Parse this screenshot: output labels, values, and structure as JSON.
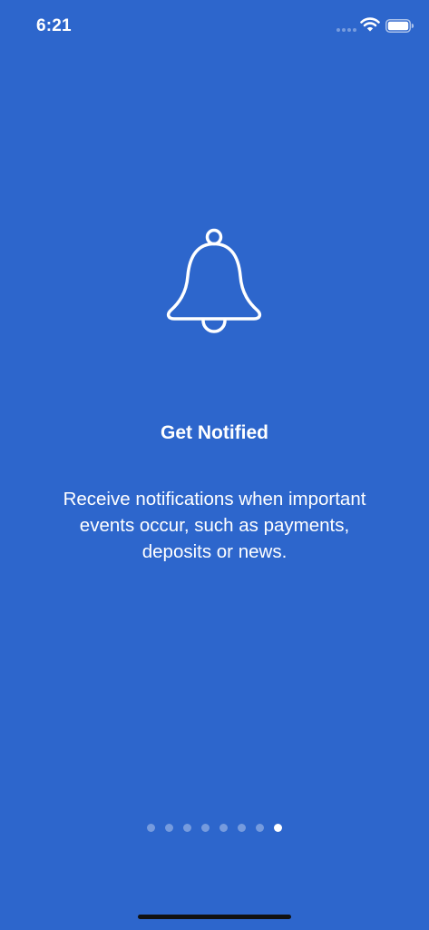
{
  "status_bar": {
    "time": "6:21",
    "icons": [
      "cellular-signal-icon",
      "wifi-icon",
      "battery-icon"
    ]
  },
  "onboarding": {
    "icon": "bell-icon",
    "title": "Get Notified",
    "description": "Receive notifications when important events occur, such as payments, deposits or news."
  },
  "pagination": {
    "total_pages": 8,
    "current_page": 8
  },
  "colors": {
    "background": "#2d66cc",
    "foreground": "#ffffff",
    "inactive_dot": "rgba(255,255,255,0.35)"
  }
}
